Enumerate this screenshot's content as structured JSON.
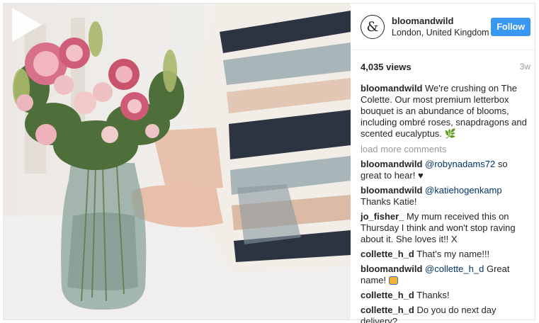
{
  "profile": {
    "avatar_glyph": "&",
    "username": "bloomandwild",
    "location": "London, United Kingdom",
    "follow_label": "Follow"
  },
  "stats": {
    "views": "4,035 views",
    "age": "3w"
  },
  "caption": {
    "user": "bloomandwild",
    "text": "We're crushing on The Colette. Our most premium letterbox bouquet is an abundance of blooms, including ombré roses, snapdragons and scented eucalyptus.",
    "emoji": "🌿"
  },
  "load_more": "load more comments",
  "comments": [
    {
      "user": "bloomandwild",
      "mention": "@robynadams72",
      "text": "so great to hear!",
      "emoji": "♥"
    },
    {
      "user": "bloomandwild",
      "mention": "@katiehogenkamp",
      "text": "Thanks Katie!"
    },
    {
      "user": "jo_fisher_",
      "text": "My mum received this on Thursday I think and won't stop raving about it. She loves it!! X"
    },
    {
      "user": "collette_h_d",
      "text": "That's my name!!!"
    },
    {
      "user": "bloomandwild",
      "mention": "@collette_h_d",
      "text": "Great name!",
      "emoji": "bear-emoji"
    },
    {
      "user": "collette_h_d",
      "text": "Thanks!"
    },
    {
      "user": "collette_h_d",
      "text": "Do you do next day delivery?"
    }
  ],
  "icons": {
    "play": "play-icon"
  },
  "colors": {
    "accent": "#3897f0",
    "mention": "#003569"
  }
}
